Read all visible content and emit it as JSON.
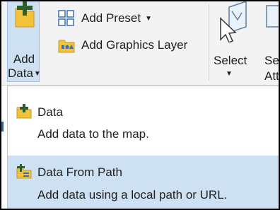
{
  "ribbon": {
    "add_data": {
      "line1": "Add",
      "line2": "Data",
      "icon": "add-data-icon"
    },
    "add_preset": {
      "label": "Add Preset",
      "icon": "add-preset-icon"
    },
    "add_graphics_layer": {
      "label": "Add Graphics Layer",
      "icon": "graphics-layer-icon"
    },
    "select": {
      "label": "Select",
      "icon": "select-cursor-icon"
    },
    "select_by_attributes": {
      "line1": "Se",
      "line2": "Att",
      "icon": "select-by-attributes-icon"
    }
  },
  "menu": {
    "items": [
      {
        "title": "Data",
        "description": "Add data to the map.",
        "icon": "add-data-small-icon"
      },
      {
        "title": "Data From Path",
        "description": "Add data using a local path or URL.",
        "icon": "data-from-path-icon"
      }
    ]
  },
  "colors": {
    "highlight": "#cde1f3",
    "highlight_border": "#9cc2e6",
    "ribbon_bg": "#f3f3f3",
    "folder_yellow": "#f2c33a"
  }
}
